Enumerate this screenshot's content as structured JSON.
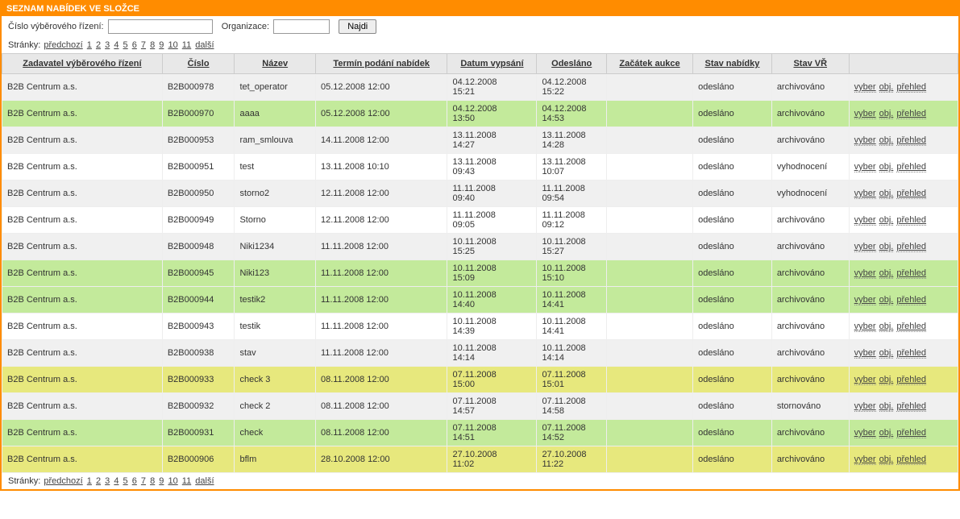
{
  "header": {
    "title": "SEZNAM NABÍDEK VE SLOŽCE"
  },
  "filter": {
    "tender_label": "Číslo výběrového řízení:",
    "org_label": "Organizace:",
    "find_button": "Najdi",
    "tender_value": "",
    "org_value": ""
  },
  "pager": {
    "label": "Stránky:",
    "prev": "předchozí",
    "pages": [
      "1",
      "2",
      "3",
      "4",
      "5",
      "6",
      "7",
      "8",
      "9",
      "10",
      "11"
    ],
    "next": "další"
  },
  "columns": [
    "Zadavatel výběrového řízení",
    "Číslo",
    "Název",
    "Termín podání nabídek",
    "Datum vypsání",
    "Odesláno",
    "Začátek aukce",
    "Stav nabídky",
    "Stav VŘ"
  ],
  "action_links": {
    "vyber": "vyber",
    "obj": "obj.",
    "prehled": "přehled"
  },
  "rows": [
    {
      "style": "gray",
      "zadavatel": "B2B Centrum a.s.",
      "cislo": "B2B000978",
      "nazev": "tet_operator",
      "termin": "05.12.2008 12:00",
      "vypsani": "04.12.2008 15:21",
      "odeslano": "04.12.2008 15:22",
      "aukce": "",
      "stav_nab": "odesláno",
      "stav_vr": "archivováno"
    },
    {
      "style": "green",
      "zadavatel": "B2B Centrum a.s.",
      "cislo": "B2B000970",
      "nazev": "aaaa",
      "termin": "05.12.2008 12:00",
      "vypsani": "04.12.2008 13:50",
      "odeslano": "04.12.2008 14:53",
      "aukce": "",
      "stav_nab": "odesláno",
      "stav_vr": "archivováno"
    },
    {
      "style": "gray",
      "zadavatel": "B2B Centrum a.s.",
      "cislo": "B2B000953",
      "nazev": "ram_smlouva",
      "termin": "14.11.2008 12:00",
      "vypsani": "13.11.2008 14:27",
      "odeslano": "13.11.2008 14:28",
      "aukce": "",
      "stav_nab": "odesláno",
      "stav_vr": "archivováno"
    },
    {
      "style": "plain",
      "zadavatel": "B2B Centrum a.s.",
      "cislo": "B2B000951",
      "nazev": "test",
      "termin": "13.11.2008 10:10",
      "vypsani": "13.11.2008 09:43",
      "odeslano": "13.11.2008 10:07",
      "aukce": "",
      "stav_nab": "odesláno",
      "stav_vr": "vyhodnocení"
    },
    {
      "style": "gray",
      "zadavatel": "B2B Centrum a.s.",
      "cislo": "B2B000950",
      "nazev": "storno2",
      "termin": "12.11.2008 12:00",
      "vypsani": "11.11.2008 09:40",
      "odeslano": "11.11.2008 09:54",
      "aukce": "",
      "stav_nab": "odesláno",
      "stav_vr": "vyhodnocení"
    },
    {
      "style": "plain",
      "zadavatel": "B2B Centrum a.s.",
      "cislo": "B2B000949",
      "nazev": "Storno",
      "termin": "12.11.2008 12:00",
      "vypsani": "11.11.2008 09:05",
      "odeslano": "11.11.2008 09:12",
      "aukce": "",
      "stav_nab": "odesláno",
      "stav_vr": "archivováno"
    },
    {
      "style": "gray",
      "zadavatel": "B2B Centrum a.s.",
      "cislo": "B2B000948",
      "nazev": "Niki1234",
      "termin": "11.11.2008 12:00",
      "vypsani": "10.11.2008 15:25",
      "odeslano": "10.11.2008 15:27",
      "aukce": "",
      "stav_nab": "odesláno",
      "stav_vr": "archivováno"
    },
    {
      "style": "green",
      "zadavatel": "B2B Centrum a.s.",
      "cislo": "B2B000945",
      "nazev": "Niki123",
      "termin": "11.11.2008 12:00",
      "vypsani": "10.11.2008 15:09",
      "odeslano": "10.11.2008 15:10",
      "aukce": "",
      "stav_nab": "odesláno",
      "stav_vr": "archivováno"
    },
    {
      "style": "green",
      "zadavatel": "B2B Centrum a.s.",
      "cislo": "B2B000944",
      "nazev": "testik2",
      "termin": "11.11.2008 12:00",
      "vypsani": "10.11.2008 14:40",
      "odeslano": "10.11.2008 14:41",
      "aukce": "",
      "stav_nab": "odesláno",
      "stav_vr": "archivováno"
    },
    {
      "style": "plain",
      "zadavatel": "B2B Centrum a.s.",
      "cislo": "B2B000943",
      "nazev": "testik",
      "termin": "11.11.2008 12:00",
      "vypsani": "10.11.2008 14:39",
      "odeslano": "10.11.2008 14:41",
      "aukce": "",
      "stav_nab": "odesláno",
      "stav_vr": "archivováno"
    },
    {
      "style": "gray",
      "zadavatel": "B2B Centrum a.s.",
      "cislo": "B2B000938",
      "nazev": "stav",
      "termin": "11.11.2008 12:00",
      "vypsani": "10.11.2008 14:14",
      "odeslano": "10.11.2008 14:14",
      "aukce": "",
      "stav_nab": "odesláno",
      "stav_vr": "archivováno"
    },
    {
      "style": "yellow",
      "zadavatel": "B2B Centrum a.s.",
      "cislo": "B2B000933",
      "nazev": "check 3",
      "termin": "08.11.2008 12:00",
      "vypsani": "07.11.2008 15:00",
      "odeslano": "07.11.2008 15:01",
      "aukce": "",
      "stav_nab": "odesláno",
      "stav_vr": "archivováno"
    },
    {
      "style": "gray",
      "zadavatel": "B2B Centrum a.s.",
      "cislo": "B2B000932",
      "nazev": "check 2",
      "termin": "08.11.2008 12:00",
      "vypsani": "07.11.2008 14:57",
      "odeslano": "07.11.2008 14:58",
      "aukce": "",
      "stav_nab": "odesláno",
      "stav_vr": "stornováno"
    },
    {
      "style": "green",
      "zadavatel": "B2B Centrum a.s.",
      "cislo": "B2B000931",
      "nazev": "check",
      "termin": "08.11.2008 12:00",
      "vypsani": "07.11.2008 14:51",
      "odeslano": "07.11.2008 14:52",
      "aukce": "",
      "stav_nab": "odesláno",
      "stav_vr": "archivováno"
    },
    {
      "style": "yellow",
      "zadavatel": "B2B Centrum a.s.",
      "cislo": "B2B000906",
      "nazev": "bflm",
      "termin": "28.10.2008 12:00",
      "vypsani": "27.10.2008 11:02",
      "odeslano": "27.10.2008 11:22",
      "aukce": "",
      "stav_nab": "odesláno",
      "stav_vr": "archivováno"
    }
  ]
}
